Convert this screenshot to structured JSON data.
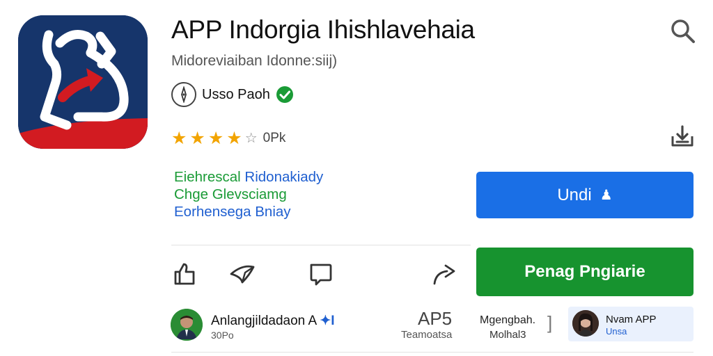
{
  "app": {
    "title": "APP Indorgia Ihishlavehaia",
    "subtitle": "Midoreviaiban Idonne:siij)",
    "developer": "Usso Paoh",
    "rating": {
      "stars_filled": 3.5,
      "stars_total": 5,
      "count_label": "0Pk"
    },
    "description": {
      "line1_a": "Eiehrescal",
      "line1_b": "Ridonakiady",
      "line2": "Chge Glevsciamg",
      "line3": "Eorhensega Bniay"
    },
    "primary_button_label": "Undi",
    "primary_button_glyph": "♟",
    "secondary_button_label": "Penag Pngiarie"
  },
  "icons": {
    "search": "search-icon",
    "install": "install-icon",
    "like": "thumbs-up-icon",
    "send": "send-icon",
    "comment": "comment-icon",
    "share": "share-icon"
  },
  "bottom": {
    "profile_name": "Anlangjildadaon A",
    "profile_mark": "✦I",
    "profile_sub": "30Po",
    "stat_value": "AP5",
    "stat_label": "Teamoatsa",
    "meta_line1": "Mgengbah.",
    "meta_line2": "Molhal3",
    "meta_bracket": "]",
    "card_title": "Nvam APP",
    "card_sub": "Unsa"
  },
  "colors": {
    "icon_bg": "#16356b",
    "accent_blue": "#1a6fe6",
    "accent_green": "#17932f",
    "star": "#f2a400",
    "verified": "#1a9b36"
  }
}
